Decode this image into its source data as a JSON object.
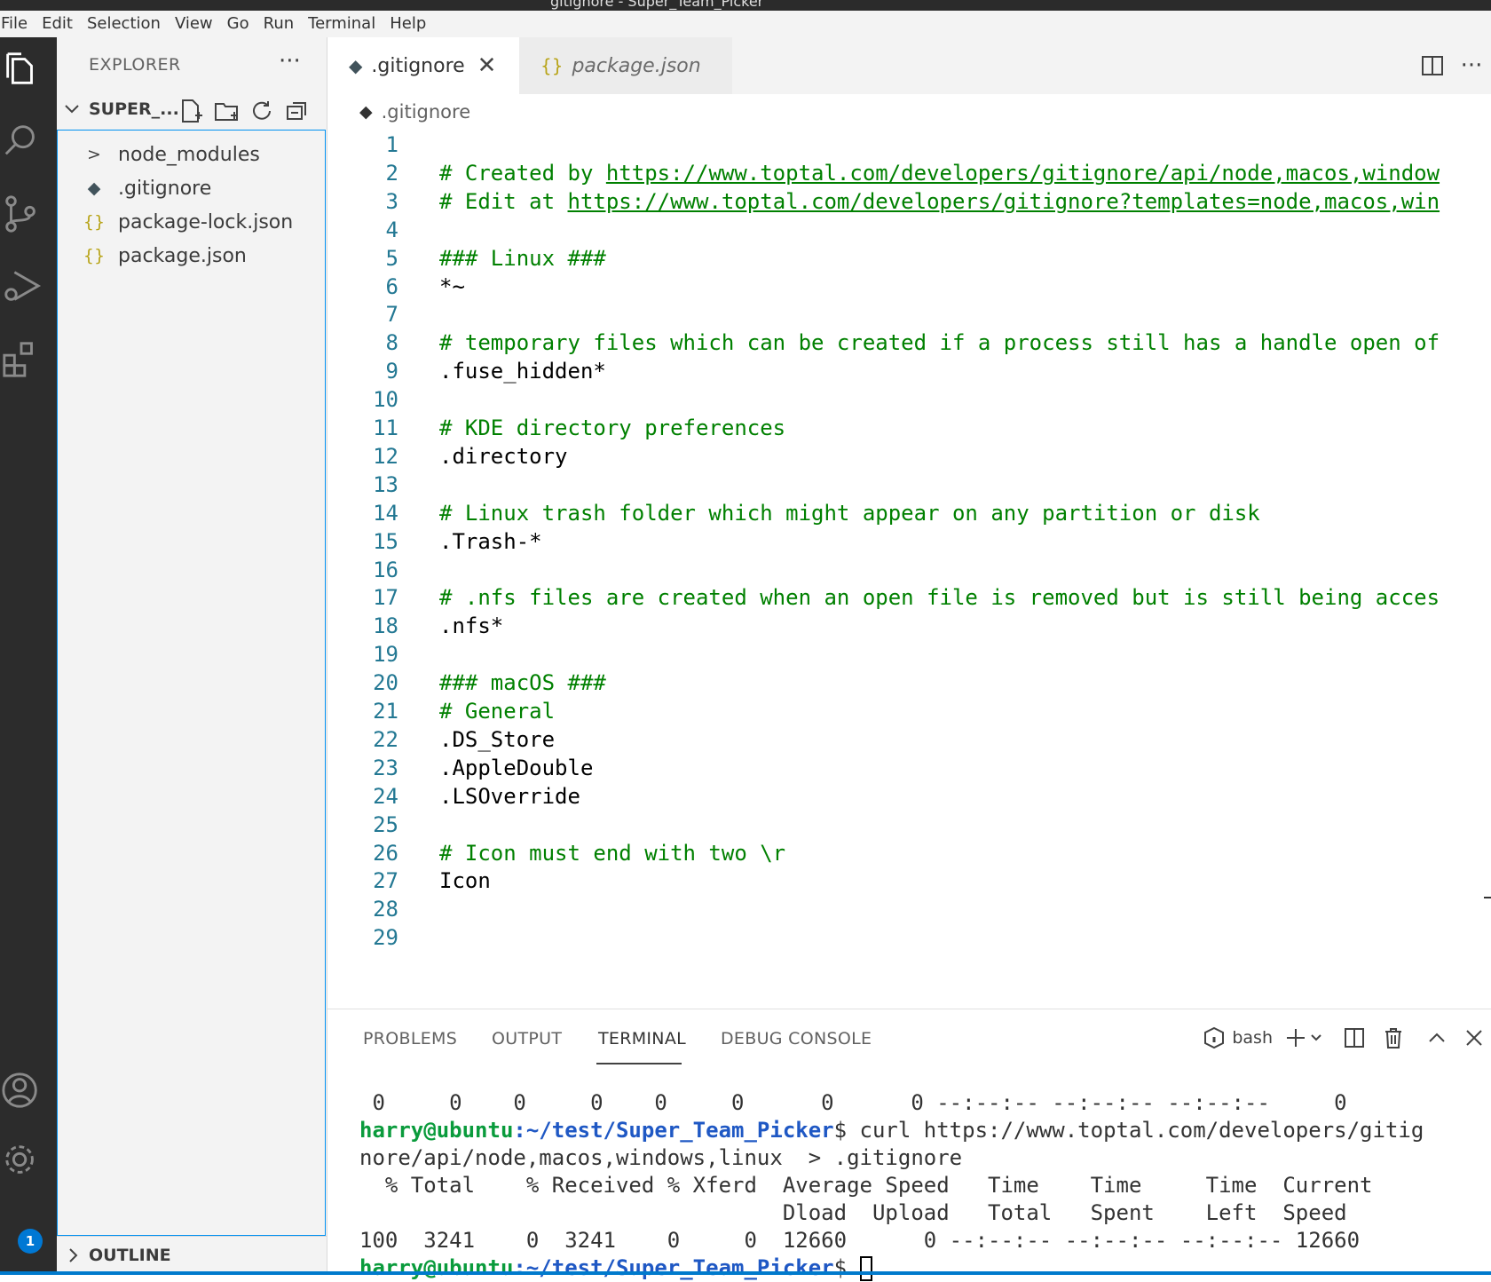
{
  "window": {
    "title": "gitignore - Super_Team_Picker"
  },
  "menubar": [
    "File",
    "Edit",
    "Selection",
    "View",
    "Go",
    "Run",
    "Terminal",
    "Help"
  ],
  "activity_bar": {
    "items": [
      "files-icon",
      "search-icon",
      "source-control-icon",
      "run-debug-icon",
      "extensions-icon"
    ],
    "bottom": [
      "account-icon",
      "settings-gear-icon"
    ],
    "settings_badge": "1"
  },
  "sidebar": {
    "header": "EXPLORER",
    "more": "···",
    "folder_name": "SUPER_...",
    "tree": [
      {
        "name": "node_modules",
        "type": "folder",
        "icon": ">"
      },
      {
        "name": ".gitignore",
        "type": "git",
        "icon": "◆"
      },
      {
        "name": "package-lock.json",
        "type": "json",
        "icon": "{}"
      },
      {
        "name": "package.json",
        "type": "json",
        "icon": "{}"
      }
    ],
    "outline_label": "OUTLINE"
  },
  "tabs": [
    {
      "label": ".gitignore",
      "icon": "◆",
      "active": true,
      "close": "✕"
    },
    {
      "label": "package.json",
      "icon": "{}",
      "active": false
    }
  ],
  "breadcrumb": {
    "file": ".gitignore"
  },
  "editor": {
    "lines": [
      {
        "n": "1",
        "text": "",
        "kind": "plain"
      },
      {
        "n": "2",
        "prefix": "# Created by ",
        "link": "https://www.toptal.com/developers/gitignore/api/node,macos,window",
        "kind": "comment"
      },
      {
        "n": "3",
        "prefix": "# Edit at ",
        "link": "https://www.toptal.com/developers/gitignore?templates=node,macos,win",
        "kind": "comment"
      },
      {
        "n": "4",
        "text": "",
        "kind": "plain"
      },
      {
        "n": "5",
        "text": "### Linux ###",
        "kind": "comment"
      },
      {
        "n": "6",
        "text": "*~",
        "kind": "plain"
      },
      {
        "n": "7",
        "text": "",
        "kind": "plain"
      },
      {
        "n": "8",
        "text": "# temporary files which can be created if a process still has a handle open of",
        "kind": "comment"
      },
      {
        "n": "9",
        "text": ".fuse_hidden*",
        "kind": "plain"
      },
      {
        "n": "10",
        "text": "",
        "kind": "plain"
      },
      {
        "n": "11",
        "text": "# KDE directory preferences",
        "kind": "comment"
      },
      {
        "n": "12",
        "text": ".directory",
        "kind": "plain"
      },
      {
        "n": "13",
        "text": "",
        "kind": "plain"
      },
      {
        "n": "14",
        "text": "# Linux trash folder which might appear on any partition or disk",
        "kind": "comment"
      },
      {
        "n": "15",
        "text": ".Trash-*",
        "kind": "plain"
      },
      {
        "n": "16",
        "text": "",
        "kind": "plain"
      },
      {
        "n": "17",
        "text": "# .nfs files are created when an open file is removed but is still being acces",
        "kind": "comment"
      },
      {
        "n": "18",
        "text": ".nfs*",
        "kind": "plain"
      },
      {
        "n": "19",
        "text": "",
        "kind": "plain"
      },
      {
        "n": "20",
        "text": "### macOS ###",
        "kind": "comment"
      },
      {
        "n": "21",
        "text": "# General",
        "kind": "comment"
      },
      {
        "n": "22",
        "text": ".DS_Store",
        "kind": "plain"
      },
      {
        "n": "23",
        "text": ".AppleDouble",
        "kind": "plain"
      },
      {
        "n": "24",
        "text": ".LSOverride",
        "kind": "plain"
      },
      {
        "n": "25",
        "text": "",
        "kind": "plain"
      },
      {
        "n": "26",
        "text": "# Icon must end with two \\r",
        "kind": "comment"
      },
      {
        "n": "27",
        "text": "Icon",
        "kind": "plain"
      },
      {
        "n": "28",
        "text": "",
        "kind": "plain"
      },
      {
        "n": "29",
        "text": "",
        "kind": "plain"
      }
    ]
  },
  "panel": {
    "tabs": [
      "PROBLEMS",
      "OUTPUT",
      "TERMINAL",
      "DEBUG CONSOLE"
    ],
    "active_tab": "TERMINAL",
    "shell": "bash",
    "terminal": {
      "line0": " 0     0    0     0    0     0      0      0 --:--:-- --:--:-- --:--:--     0",
      "prompt_user": "harry@ubuntu",
      "prompt_path": ":~/test/Super_Team_Picker",
      "prompt_sym": "$",
      "cmd1": " curl https://www.toptal.com/developers/gitig",
      "cmd1_cont": "nore/api/node,macos,windows,linux  > .gitignore",
      "hdr1": "  % Total    % Received % Xferd  Average Speed   Time    Time     Time  Current",
      "hdr2": "                                 Dload  Upload   Total   Spent    Left  Speed",
      "stats": "100  3241    0  3241    0     0  12660      0 --:--:-- --:--:-- --:--:-- 12660"
    }
  }
}
